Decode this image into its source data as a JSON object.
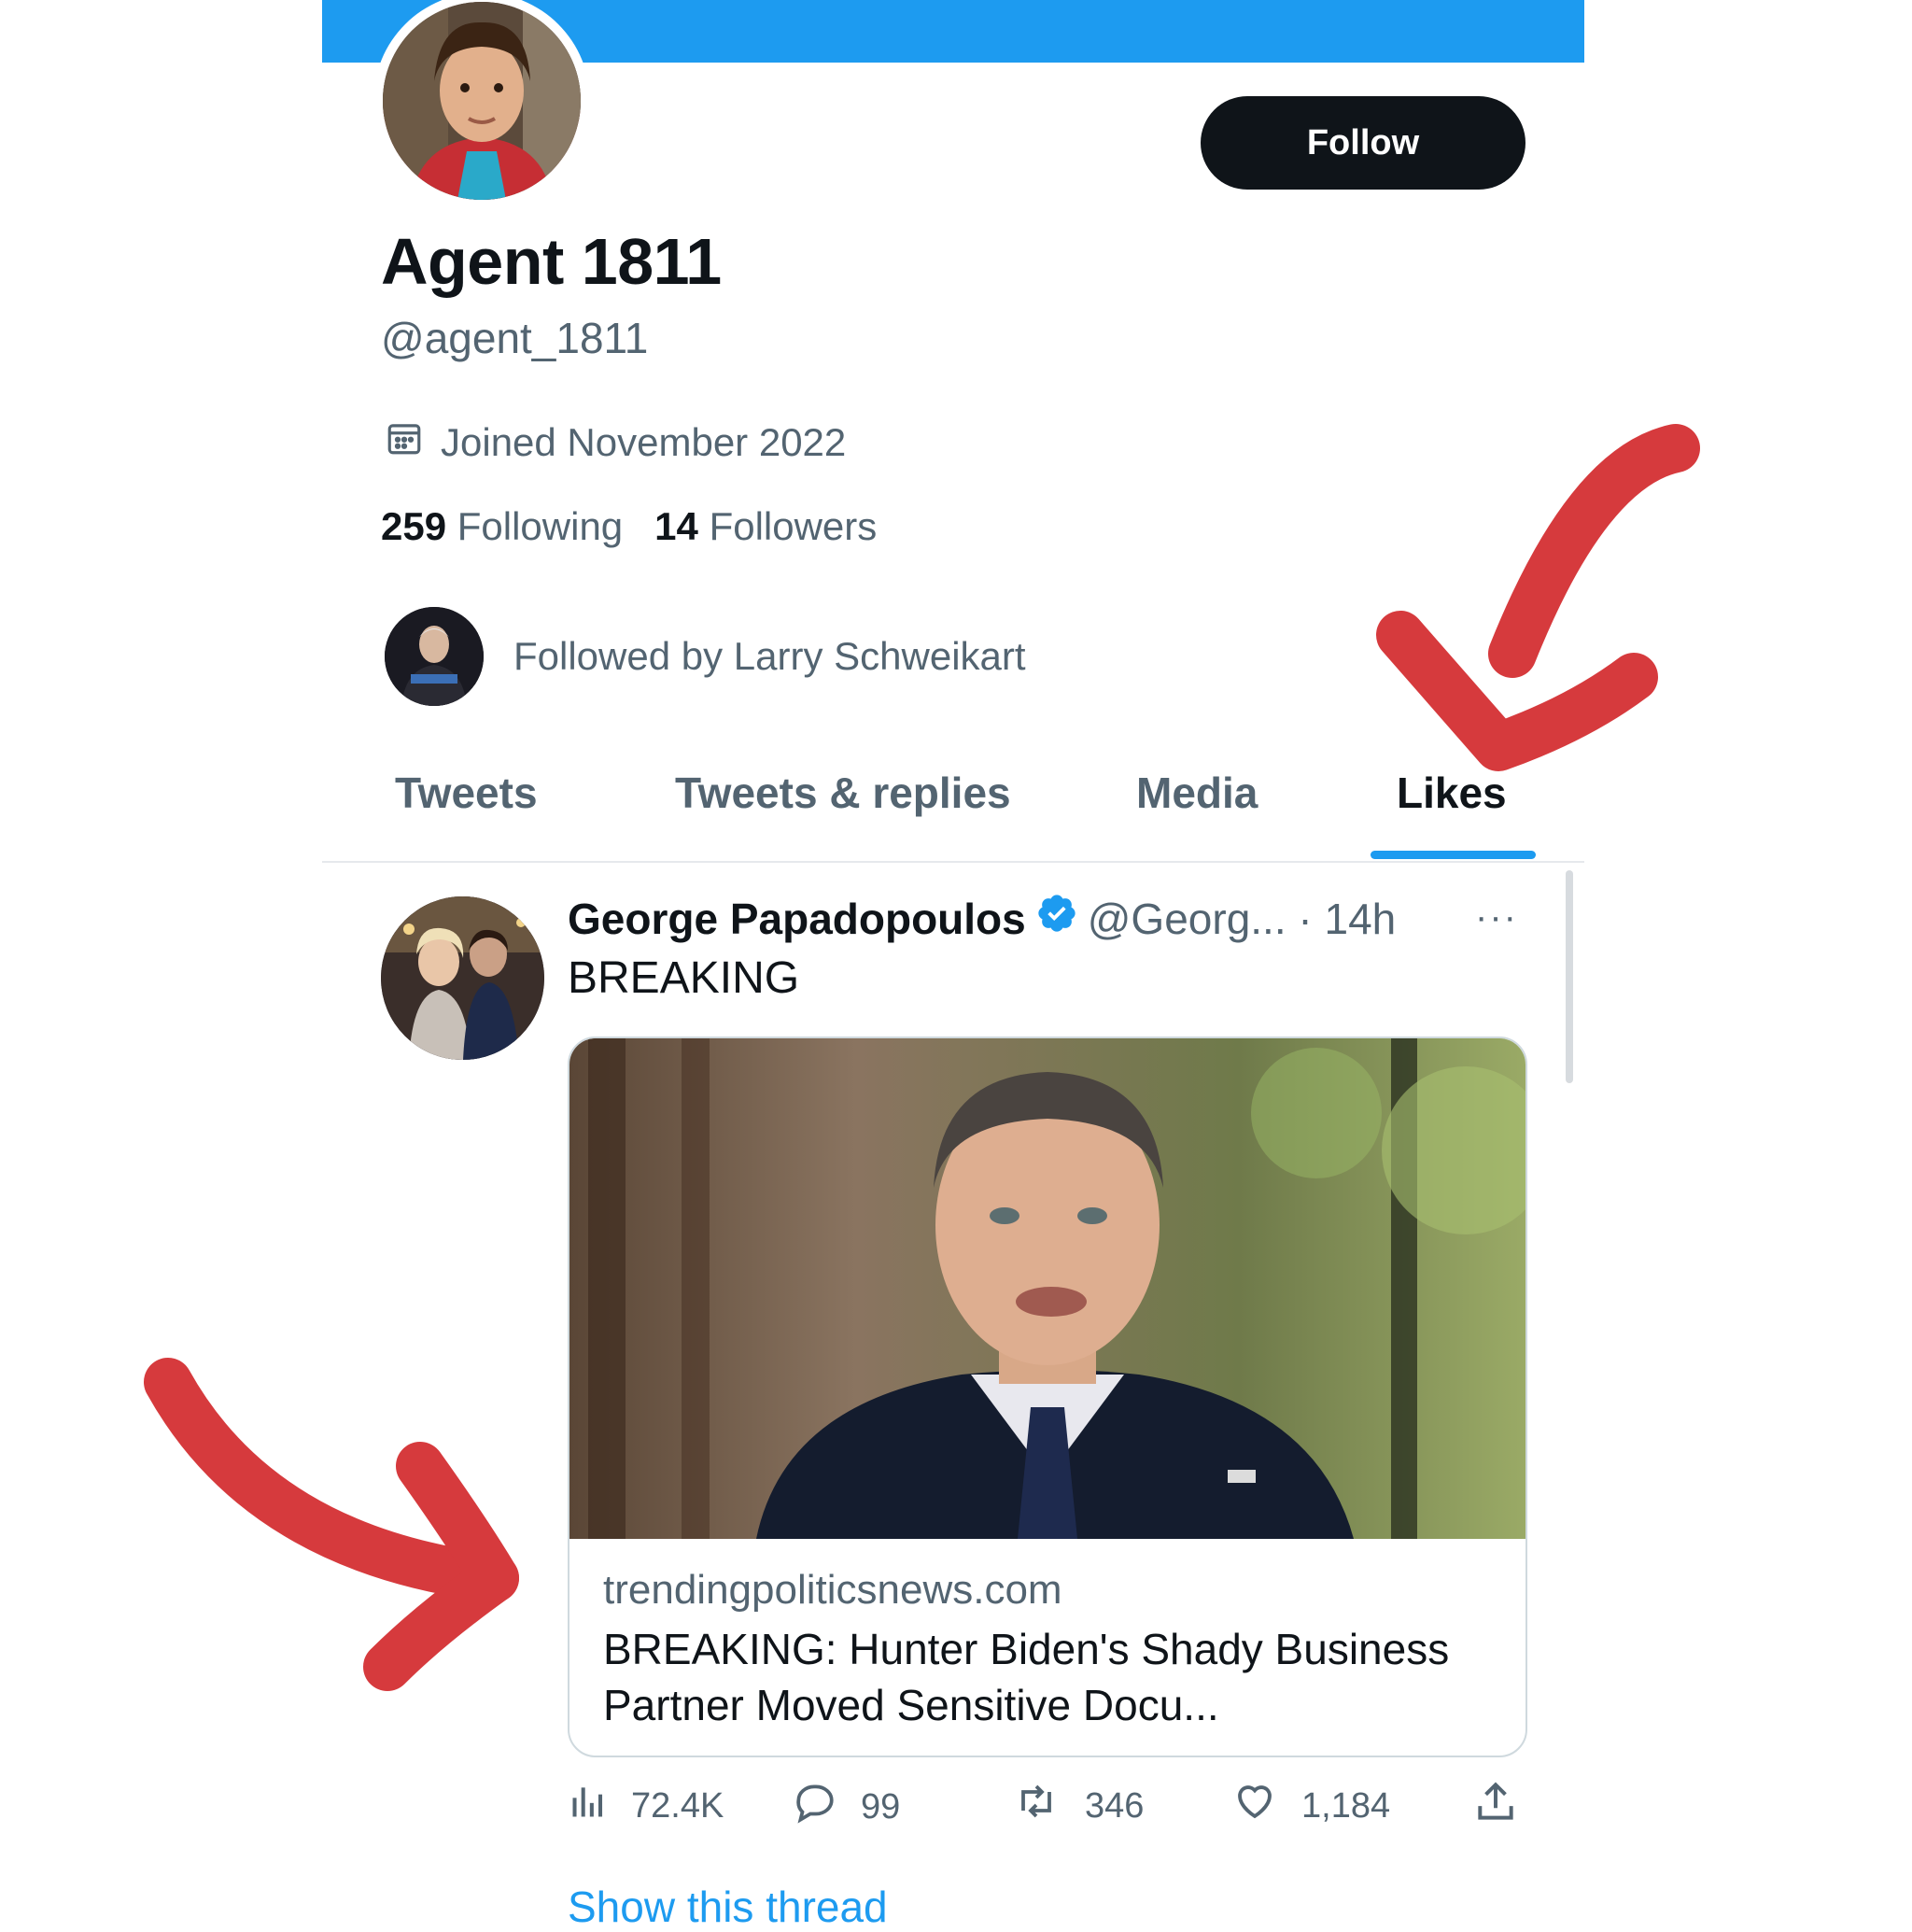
{
  "profile": {
    "display_name": "Agent 1811",
    "handle": "@agent_1811",
    "joined": "Joined November 2022",
    "following_count": "259",
    "following_label": "Following",
    "followers_count": "14",
    "followers_label": "Followers",
    "followed_by": "Followed by Larry Schweikart",
    "follow_button": "Follow"
  },
  "tabs": [
    {
      "label": "Tweets",
      "active": false
    },
    {
      "label": "Tweets & replies",
      "active": false
    },
    {
      "label": "Media",
      "active": false
    },
    {
      "label": "Likes",
      "active": true
    }
  ],
  "tweet": {
    "author": "George Papadopoulos",
    "verified": true,
    "handle": "@Georg...",
    "separator": "·",
    "time": "14h",
    "more": "···",
    "text": "BREAKING",
    "card": {
      "domain": "trendingpoliticsnews.com",
      "title": "BREAKING: Hunter Biden's Shady Business Partner Moved Sensitive Docu..."
    },
    "actions": {
      "views": "72.4K",
      "replies": "99",
      "retweets": "346",
      "likes": "1,184"
    },
    "show_thread": "Show this thread"
  },
  "colors": {
    "accent": "#1d9bf0",
    "text": "#0f1419",
    "muted": "#536471",
    "annotation_arrow": "#d63a3d"
  },
  "icons": [
    "calendar-icon",
    "verified-badge-icon",
    "more-icon",
    "views-icon",
    "reply-icon",
    "retweet-icon",
    "like-icon",
    "share-icon"
  ]
}
